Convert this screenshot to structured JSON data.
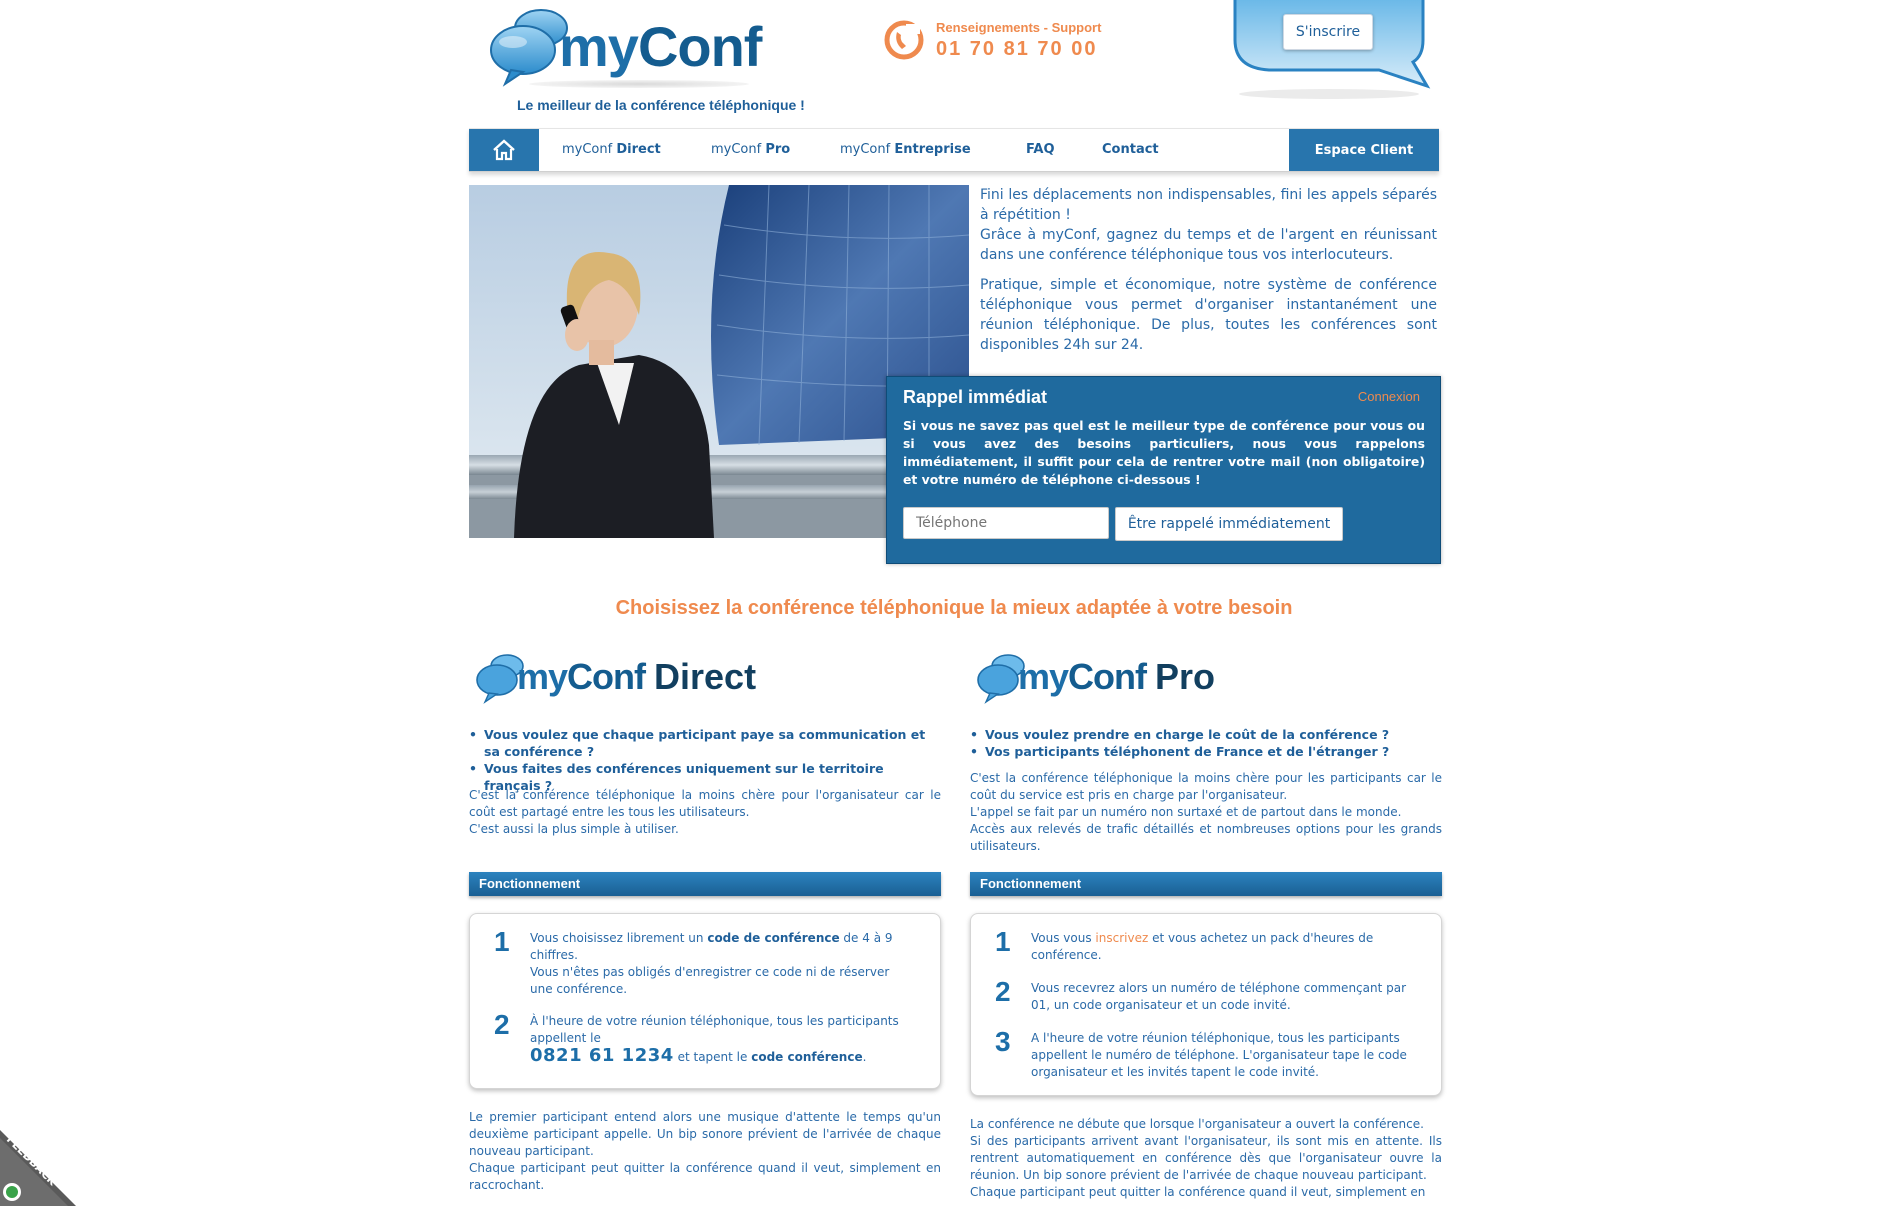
{
  "header": {
    "logo_my": "my",
    "logo_conf": "Conf",
    "tagline": "Le meilleur de la conférence téléphonique !",
    "support_label": "Renseignements - Support",
    "support_phone": "01 70 81 70 00",
    "signup_button": "S'inscrire"
  },
  "nav": {
    "items": [
      {
        "prefix": "myConf",
        "label": "Direct"
      },
      {
        "prefix": "myConf",
        "label": "Pro"
      },
      {
        "prefix": "myConf",
        "label": "Entreprise"
      },
      {
        "prefix": "",
        "label": "FAQ"
      },
      {
        "prefix": "",
        "label": "Contact"
      }
    ],
    "client_area": "Espace Client"
  },
  "hero": {
    "paragraph1a": "Fini les déplacements non indispensables, fini les appels séparés à répétition !",
    "paragraph1b": "Grâce à myConf, gagnez du temps et de l'argent en réunissant dans une conférence téléphonique tous vos interlocuteurs.",
    "paragraph2": "Pratique, simple et économique, notre système de conférence téléphonique vous permet d'organiser instantanément une réunion téléphonique. De plus, toutes les conférences sont disponibles 24h sur 24."
  },
  "callback": {
    "title": "Rappel immédiat",
    "login_link": "Connexion",
    "text": "Si vous ne savez pas quel est le meilleur type de conférence pour vous ou si vous avez des besoins particuliers, nous vous rappelons immédiatement, il suffit pour cela de rentrer votre mail (non obligatoire) et votre numéro de téléphone ci-dessous !",
    "phone_placeholder": "Téléphone",
    "submit_label": "Être rappelé immédiatement"
  },
  "choose_heading": "Choisissez la conférence téléphonique la mieux adaptée à votre besoin",
  "direct": {
    "logo_my": "my",
    "logo_conf": "Conf",
    "logo_suffix": "Direct",
    "bullets": [
      "Vous voulez que chaque participant paye sa communication et sa conférence ?",
      "Vous faites des conférences uniquement sur le territoire français ?"
    ],
    "desc_lines": [
      "C'est la conférence téléphonique la moins chère pour l'organisateur car le coût est partagé entre les tous les utilisateurs.",
      "C'est aussi la plus simple à utiliser."
    ],
    "fonctionnement_title": "Fonctionnement",
    "step1_num": "1",
    "step1_a": "Vous choisissez librement un ",
    "step1_strong": "code de conférence",
    "step1_b": " de 4 à 9 chiffres.",
    "step1_c": "Vous n'êtes pas obligés d'enregistrer ce code ni de réserver une conférence.",
    "step2_num": "2",
    "step2_a": "À l'heure de votre réunion téléphonique, tous les participants appellent le",
    "step2_number": "0821 61 1234",
    "step2_b": " et tapent le ",
    "step2_strong": "code conférence",
    "step2_c": ".",
    "footer_lines": [
      "Le premier participant entend alors une musique d'attente le temps qu'un deuxième participant appelle. Un bip sonore prévient de l'arrivée de chaque nouveau participant.",
      "Chaque participant peut quitter la conférence quand il veut, simplement en raccrochant."
    ]
  },
  "pro": {
    "logo_my": "my",
    "logo_conf": "Conf",
    "logo_suffix": "Pro",
    "bullets": [
      "Vous voulez prendre en charge le coût de la conférence ?",
      "Vos participants téléphonent de France et de l'étranger ?"
    ],
    "desc_lines": [
      "C'est la conférence téléphonique la moins chère pour les participants car le coût du service est pris en charge par l'organisateur.",
      "L'appel se fait par un numéro non surtaxé et de partout dans le monde.",
      "Accès aux relevés de trafic détaillés et nombreuses options pour les grands utilisateurs."
    ],
    "fonctionnement_title": "Fonctionnement",
    "step1_num": "1",
    "step1_a": "Vous vous ",
    "step1_link": "inscrivez",
    "step1_b": " et vous achetez un pack d'heures de conférence.",
    "step2_num": "2",
    "step2_text": "Vous recevrez alors un numéro de téléphone commençant par 01, un code organisateur et un code invité.",
    "step3_num": "3",
    "step3_text": "A l'heure de votre réunion téléphonique, tous les participants appellent le numéro de téléphone. L'organisateur tape le code organisateur et les invités tapent le code invité.",
    "footer_lines": [
      "La conférence ne débute que lorsque l'organisateur a ouvert la conférence.",
      "Si des participants arrivent avant l'organisateur, ils sont mis en attente. Ils rentrent automatiquement en conférence dès que l'organisateur ouvre la réunion. Un bip sonore prévient de l'arrivée de chaque nouveau participant.",
      "Chaque participant peut quitter la conférence quand il veut, simplement en"
    ]
  },
  "feedback_label": "FEEDBACK",
  "colors": {
    "primary_blue": "#2875ad",
    "text_blue": "#2a6aa8",
    "accent_orange": "#ef8a4e"
  }
}
